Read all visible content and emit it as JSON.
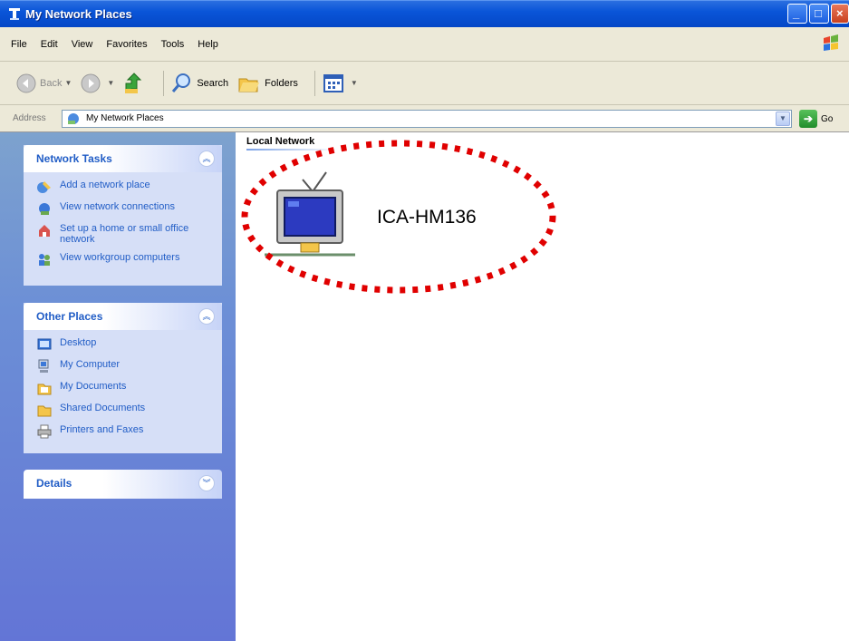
{
  "window": {
    "title": "My Network Places"
  },
  "menu": {
    "items": [
      "File",
      "Edit",
      "View",
      "Favorites",
      "Tools",
      "Help"
    ]
  },
  "toolbar": {
    "back_label": "Back",
    "search_label": "Search",
    "folders_label": "Folders"
  },
  "address": {
    "label": "Address",
    "value": "My Network Places",
    "go_label": "Go"
  },
  "sidebar": {
    "network_tasks": {
      "title": "Network Tasks",
      "items": [
        "Add a network place",
        "View network connections",
        "Set up a home or small office network",
        "View workgroup computers"
      ]
    },
    "other_places": {
      "title": "Other Places",
      "items": [
        "Desktop",
        "My Computer",
        "My Documents",
        "Shared Documents",
        "Printers and Faxes"
      ]
    },
    "details": {
      "title": "Details"
    }
  },
  "content": {
    "group_title": "Local Network",
    "device_name": "ICA-HM136"
  },
  "colors": {
    "titlebar": "#0a55d8",
    "taskpane": "#6c8fd6",
    "link": "#215dc6",
    "highlight": "#e00000"
  }
}
